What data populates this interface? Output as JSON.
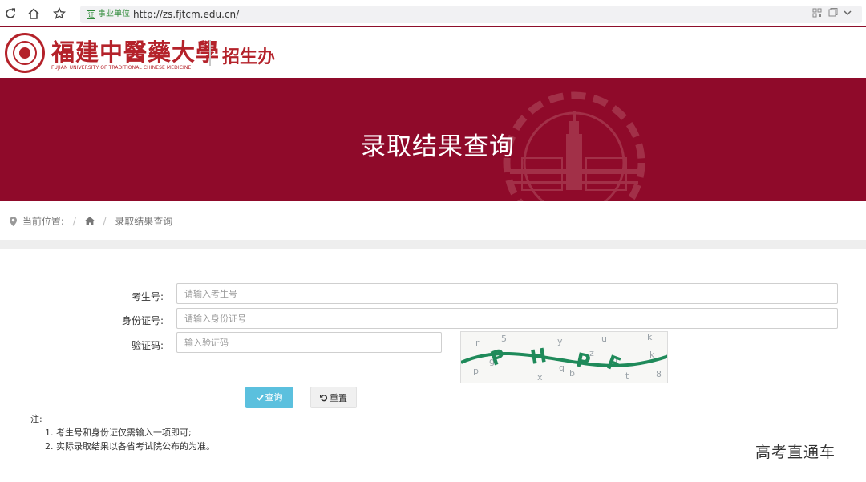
{
  "browser": {
    "cert_label": "事业单位",
    "url": "http://zs.fjtcm.edu.cn/"
  },
  "header": {
    "university_name": "福建中醫藥大學",
    "university_name_en": "FUJIAN UNIVERSITY OF TRADITIONAL CHINESE MEDICINE",
    "office_name": "招生办"
  },
  "banner": {
    "title": "录取结果查询"
  },
  "breadcrumb": {
    "current_label": "当前位置:",
    "separator": "/",
    "page": "录取结果查询"
  },
  "form": {
    "exam_id": {
      "label": "考生号:",
      "placeholder": "请输入考生号"
    },
    "id_card": {
      "label": "身份证号:",
      "placeholder": "请输入身份证号"
    },
    "captcha": {
      "label": "验证码:",
      "placeholder": "输入验证码"
    },
    "query_label": "查询",
    "reset_label": "重置"
  },
  "notes": {
    "title": "注:",
    "items": [
      "1.  考生号和身份证仅需输入一项即可;",
      "2.  实际录取结果以各省考试院公布的为准。"
    ]
  },
  "watermark": "高考直通车",
  "colors": {
    "brand_red": "#8f0a2a",
    "logo_red": "#b4222a",
    "query_button": "#5bc0de"
  }
}
